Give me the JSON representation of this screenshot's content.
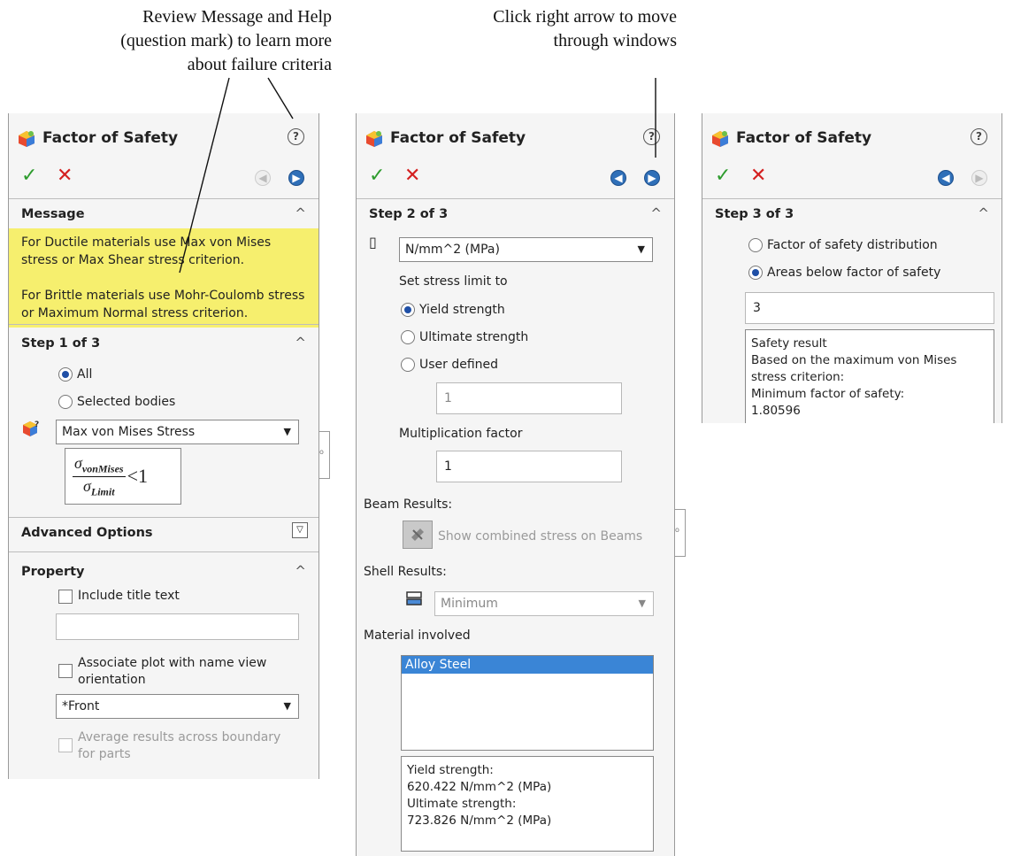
{
  "callouts": {
    "left": [
      "Review Message and Help",
      "(question mark) to learn more",
      "about failure criteria"
    ],
    "right": [
      "Click right arrow to move",
      "through windows"
    ]
  },
  "colors": {
    "message_bg": "#f6ef6e",
    "ok": "#2e9c2e",
    "cancel": "#d42020",
    "selected": "#3a85d6"
  },
  "panel1": {
    "title": "Factor of Safety",
    "help": "?",
    "message_header": "Message",
    "message_p1": "For Ductile materials use Max von Mises stress or Max Shear stress criterion.",
    "message_p2": "For Brittle materials use Mohr-Coulomb stress or Maximum Normal stress criterion.",
    "step_header": "Step 1 of 3",
    "radio_all": "All",
    "radio_selected": "Selected bodies",
    "criterion": "Max von Mises Stress",
    "formula_num": "σ",
    "formula_num_sub": "vonMises",
    "formula_den": "σ",
    "formula_den_sub": "Limit",
    "formula_rel": "<1",
    "advanced_header": "Advanced Options",
    "property_header": "Property",
    "include_title": "Include title text",
    "title_text_value": "",
    "associate_plot": "Associate plot with name view orientation",
    "view_orientation": "*Front",
    "average_results": "Average results across boundary for parts"
  },
  "panel2": {
    "title": "Factor of Safety",
    "help": "?",
    "step_header": "Step 2 of 3",
    "units": "N/mm^2 (MPa)",
    "set_stress_limit": "Set stress limit to",
    "yield": "Yield strength",
    "ultimate": "Ultimate strength",
    "user_defined": "User defined",
    "user_value": "1",
    "multiplication_label": "Multiplication factor",
    "multiplication_value": "1",
    "beam_results": "Beam Results:",
    "beam_button": "Show combined stress on Beams",
    "shell_results": "Shell Results:",
    "shell_option": "Minimum",
    "material_involved": "Material involved",
    "materials": [
      "Alloy Steel"
    ],
    "info_lines": [
      "Yield strength:",
      "620.422 N/mm^2 (MPa)",
      "Ultimate strength:",
      "723.826 N/mm^2 (MPa)"
    ]
  },
  "panel3": {
    "title": "Factor of Safety",
    "help": "?",
    "step_header": "Step 3 of 3",
    "distribution": "Factor of safety distribution",
    "areas_below": "Areas below factor of safety",
    "fos_value": "3",
    "result_lines": [
      "Safety result",
      "Based on the maximum von Mises",
      "stress criterion:",
      "Minimum factor of safety:",
      "1.80596"
    ]
  }
}
